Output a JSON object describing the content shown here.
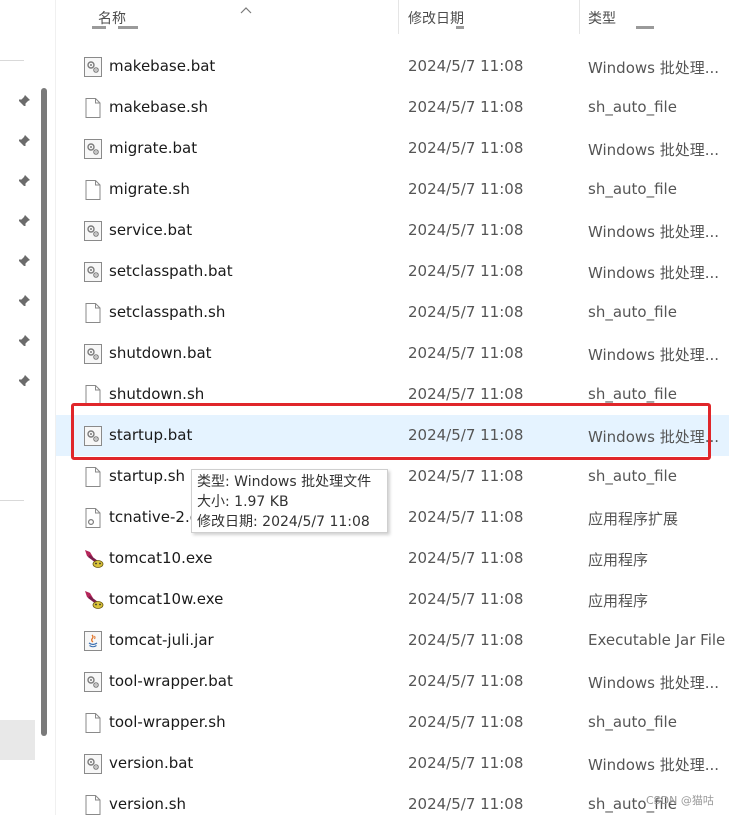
{
  "header": {
    "name_label": "名称",
    "date_label": "修改日期",
    "type_label": "类型"
  },
  "files": [
    {
      "name": "makebase.bat",
      "date": "2024/5/7 11:08",
      "type": "Windows 批处理...",
      "icon": "batch-file-icon"
    },
    {
      "name": "makebase.sh",
      "date": "2024/5/7 11:08",
      "type": "sh_auto_file",
      "icon": "blank-file-icon"
    },
    {
      "name": "migrate.bat",
      "date": "2024/5/7 11:08",
      "type": "Windows 批处理...",
      "icon": "batch-file-icon"
    },
    {
      "name": "migrate.sh",
      "date": "2024/5/7 11:08",
      "type": "sh_auto_file",
      "icon": "blank-file-icon"
    },
    {
      "name": "service.bat",
      "date": "2024/5/7 11:08",
      "type": "Windows 批处理...",
      "icon": "batch-file-icon"
    },
    {
      "name": "setclasspath.bat",
      "date": "2024/5/7 11:08",
      "type": "Windows 批处理...",
      "icon": "batch-file-icon"
    },
    {
      "name": "setclasspath.sh",
      "date": "2024/5/7 11:08",
      "type": "sh_auto_file",
      "icon": "blank-file-icon"
    },
    {
      "name": "shutdown.bat",
      "date": "2024/5/7 11:08",
      "type": "Windows 批处理...",
      "icon": "batch-file-icon"
    },
    {
      "name": "shutdown.sh",
      "date": "2024/5/7 11:08",
      "type": "sh_auto_file",
      "icon": "blank-file-icon"
    },
    {
      "name": "startup.bat",
      "date": "2024/5/7 11:08",
      "type": "Windows 批处理...",
      "icon": "batch-file-icon"
    },
    {
      "name": "startup.sh",
      "date": "2024/5/7 11:08",
      "type": "sh_auto_file",
      "icon": "blank-file-icon"
    },
    {
      "name": "tcnative-2.d",
      "date": "2024/5/7 11:08",
      "type": "应用程序扩展",
      "icon": "dll-file-icon"
    },
    {
      "name": "tomcat10.exe",
      "date": "2024/5/7 11:08",
      "type": "应用程序",
      "icon": "tomcat-exe-icon"
    },
    {
      "name": "tomcat10w.exe",
      "date": "2024/5/7 11:08",
      "type": "应用程序",
      "icon": "tomcat-exe-icon"
    },
    {
      "name": "tomcat-juli.jar",
      "date": "2024/5/7 11:08",
      "type": "Executable Jar File",
      "icon": "jar-file-icon"
    },
    {
      "name": "tool-wrapper.bat",
      "date": "2024/5/7 11:08",
      "type": "Windows 批处理...",
      "icon": "batch-file-icon"
    },
    {
      "name": "tool-wrapper.sh",
      "date": "2024/5/7 11:08",
      "type": "sh_auto_file",
      "icon": "blank-file-icon"
    },
    {
      "name": "version.bat",
      "date": "2024/5/7 11:08",
      "type": "Windows 批处理...",
      "icon": "batch-file-icon"
    },
    {
      "name": "version.sh",
      "date": "2024/5/7 11:08",
      "type": "sh_auto_file",
      "icon": "blank-file-icon"
    }
  ],
  "selected_index": 9,
  "tooltip": {
    "type_line": "类型: Windows 批处理文件",
    "size_line": "大小: 1.97 KB",
    "date_line": "修改日期: 2024/5/7 11:08"
  },
  "watermark": "CSDN @猫咕",
  "colors": {
    "selection": "#e5f3ff",
    "highlight_border": "#e0262a"
  }
}
